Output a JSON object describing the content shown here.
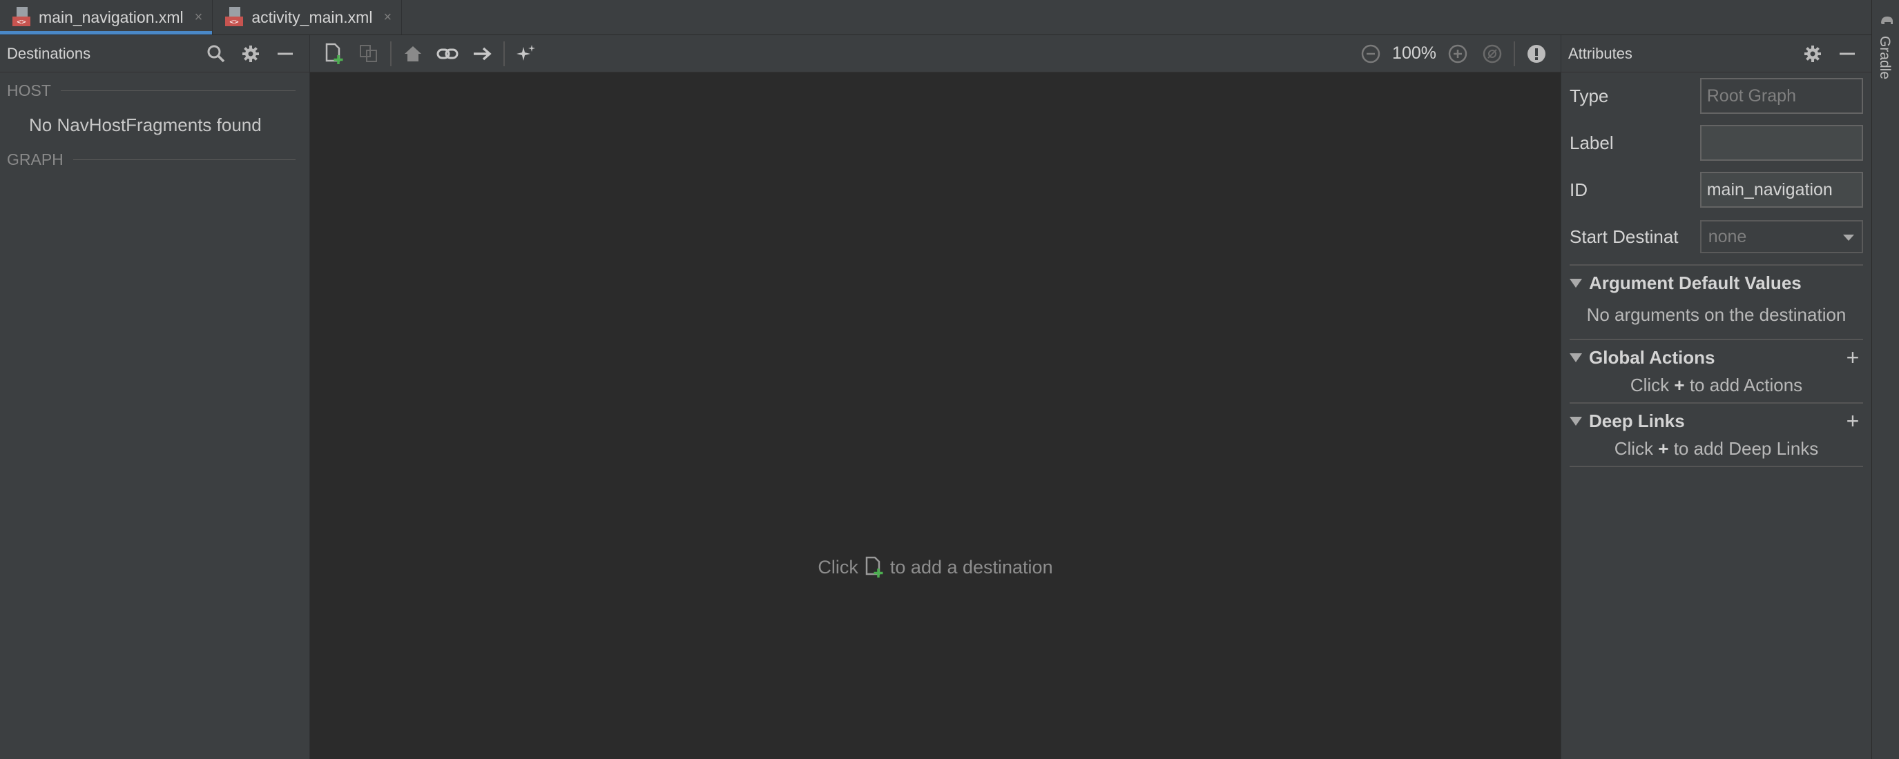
{
  "tabs": [
    {
      "label": "main_navigation.xml",
      "active": true,
      "icon": "xml-file-icon"
    },
    {
      "label": "activity_main.xml",
      "active": false,
      "icon": "xml-file-icon"
    }
  ],
  "tab_close": "×",
  "gradle": {
    "label": "Gradle",
    "icon": "elephant-icon"
  },
  "destinations": {
    "title": "Destinations",
    "host_section": "HOST",
    "host_empty": "No NavHostFragments found",
    "graph_section": "GRAPH"
  },
  "toolbar": {
    "zoom": "100%"
  },
  "canvas": {
    "hint_before": "Click",
    "hint_after": "to add a destination"
  },
  "attributes": {
    "title": "Attributes",
    "type_label": "Type",
    "type_value": "Root Graph",
    "label_label": "Label",
    "label_value": "",
    "id_label": "ID",
    "id_value": "main_navigation",
    "start_label": "Start Destinat",
    "start_value": "none",
    "argument_defaults": {
      "title": "Argument Default Values",
      "empty": "No arguments on the destination"
    },
    "global_actions": {
      "title": "Global Actions",
      "hint_pre": "Click",
      "hint_plus": "+",
      "hint_post": "to add Actions"
    },
    "deep_links": {
      "title": "Deep Links",
      "hint_pre": "Click",
      "hint_plus": "+",
      "hint_post": "to add Deep Links"
    }
  },
  "colors": {
    "accent": "#4a88c7",
    "add_green": "#4caf50",
    "background": "#2b2b2b",
    "panel": "#3c3f41"
  }
}
